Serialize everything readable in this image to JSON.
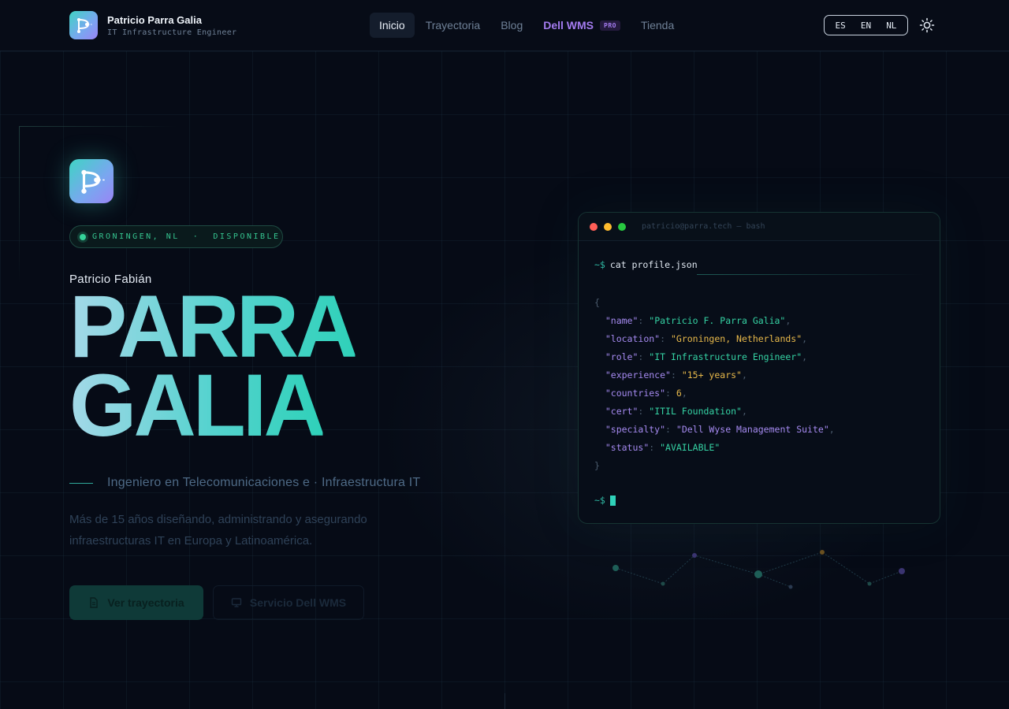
{
  "header": {
    "brand_name": "Patricio Parra Galia",
    "brand_subtitle": "IT Infrastructure Engineer",
    "nav": [
      {
        "label": "Inicio",
        "active": true
      },
      {
        "label": "Trayectoria"
      },
      {
        "label": "Blog"
      },
      {
        "label": "Dell WMS",
        "badge": "PRO"
      },
      {
        "label": "Tienda"
      }
    ],
    "languages": [
      "ES",
      "EN",
      "NL"
    ],
    "theme_icon": "sun-icon"
  },
  "hero": {
    "status_text": "GRONINGEN, NL  ·  DISPONIBLE",
    "first_name": "Patricio Fabián",
    "last_name_1": "PARRA",
    "last_name_2": "GALIA",
    "subtitle": "Ingeniero en Telecomunicaciones e · Infraestructura IT",
    "description": "Más de 15 años diseñando, administrando y asegurando infraestructuras IT en Europa y Latinoamérica.",
    "primary_button": "Ver trayectoria",
    "secondary_button": "Servicio Dell WMS"
  },
  "terminal": {
    "title": "patricio@parra.tech — bash",
    "prompt": "~$",
    "command": "cat profile.json",
    "open_brace": "{",
    "close_brace": "}",
    "entries": [
      {
        "key": "\"name\"",
        "value": "\"Patricio F. Parra Galia\"",
        "comma": ","
      },
      {
        "key": "\"location\"",
        "value": "\"Groningen, Netherlands\"",
        "comma": ","
      },
      {
        "key": "\"role\"",
        "value": "\"IT Infrastructure Engineer\"",
        "comma": ","
      },
      {
        "key": "\"experience\"",
        "value": "\"15+ years\"",
        "comma": ","
      },
      {
        "key": "\"countries\"",
        "value": "6",
        "comma": ","
      },
      {
        "key": "\"cert\"",
        "value": "\"ITIL Foundation\"",
        "comma": ","
      },
      {
        "key": "\"specialty\"",
        "value": "\"Dell Wyse Management Suite\"",
        "comma": ","
      },
      {
        "key": "\"status\"",
        "value": "\"AVAILABLE\"",
        "comma": ""
      }
    ]
  },
  "colors": {
    "accent_teal": "#2fd1b9",
    "accent_purple": "#a47cf0",
    "accent_yellow": "#e7b84a",
    "background": "#060b16"
  }
}
